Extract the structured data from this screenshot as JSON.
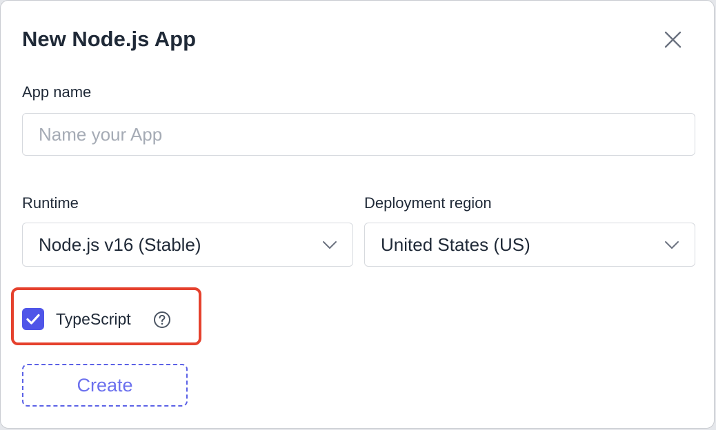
{
  "dialog": {
    "title": "New Node.js App"
  },
  "app_name": {
    "label": "App name",
    "value": "",
    "placeholder": "Name your App"
  },
  "runtime": {
    "label": "Runtime",
    "selected": "Node.js v16 (Stable)"
  },
  "region": {
    "label": "Deployment region",
    "selected": "United States (US)"
  },
  "typescript": {
    "label": "TypeScript",
    "checked": true
  },
  "actions": {
    "create_label": "Create"
  },
  "icons": {
    "close": "close-icon",
    "chevron": "chevron-down-icon",
    "check": "checkmark-icon",
    "help": "help-circle-icon"
  },
  "colors": {
    "accent": "#4f55e8",
    "button_text": "#6b70ee",
    "highlight": "#e5412d",
    "text": "#1f2937",
    "placeholder": "#a5abb5",
    "border": "#d6d9de"
  }
}
